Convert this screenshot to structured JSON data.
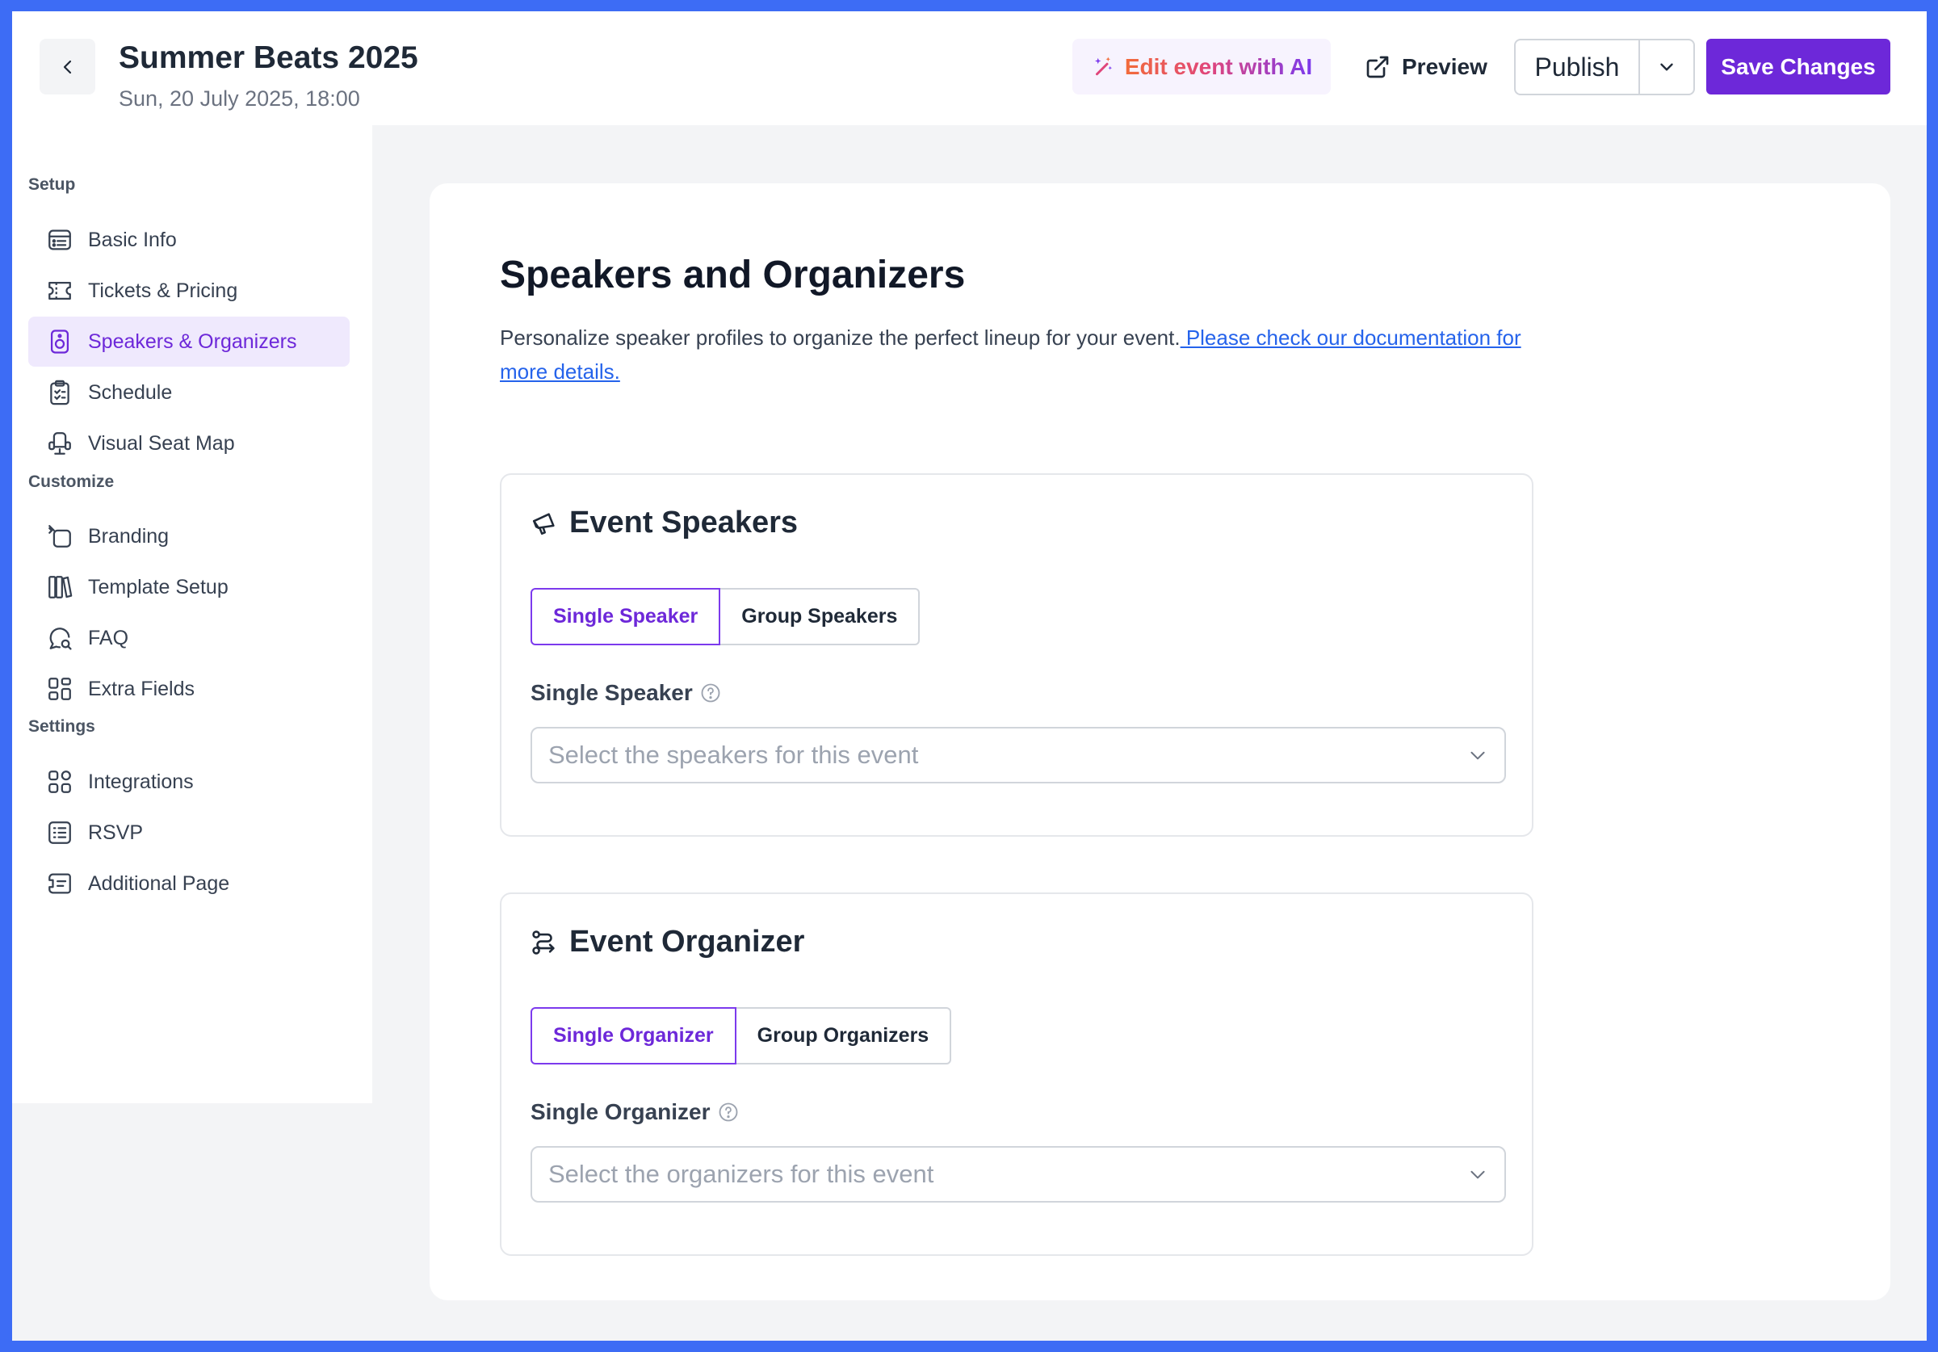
{
  "header": {
    "event_title": "Summer Beats 2025",
    "event_date": "Sun, 20 July 2025, 18:00",
    "ai_button": "Edit event with AI",
    "preview_button": "Preview",
    "publish_button": "Publish",
    "save_button": "Save Changes"
  },
  "sidebar": {
    "sections": [
      {
        "label": "Setup",
        "items": [
          {
            "label": "Basic Info",
            "icon": "basic-info-icon"
          },
          {
            "label": "Tickets & Pricing",
            "icon": "ticket-icon"
          },
          {
            "label": "Speakers & Organizers",
            "icon": "speaker-icon",
            "active": true
          },
          {
            "label": "Schedule",
            "icon": "clipboard-icon"
          },
          {
            "label": "Visual Seat Map",
            "icon": "seat-icon"
          }
        ]
      },
      {
        "label": "Customize",
        "items": [
          {
            "label": "Branding",
            "icon": "branding-icon"
          },
          {
            "label": "Template Setup",
            "icon": "template-icon"
          },
          {
            "label": "FAQ",
            "icon": "faq-icon"
          },
          {
            "label": "Extra Fields",
            "icon": "extra-fields-icon"
          }
        ]
      },
      {
        "label": "Settings",
        "items": [
          {
            "label": "Integrations",
            "icon": "integrations-icon"
          },
          {
            "label": "RSVP",
            "icon": "rsvp-icon"
          },
          {
            "label": "Additional Page",
            "icon": "additional-page-icon"
          }
        ]
      }
    ]
  },
  "main": {
    "title": "Speakers and Organizers",
    "description": "Personalize speaker profiles to organize the perfect lineup for your event.",
    "doc_link": " Please check our documentation for more details.",
    "speakers": {
      "heading": "Event Speakers",
      "tabs": [
        "Single Speaker",
        "Group Speakers"
      ],
      "field_label": "Single Speaker",
      "placeholder": "Select the speakers for this event"
    },
    "organizers": {
      "heading": "Event Organizer",
      "tabs": [
        "Single Organizer",
        "Group Organizers"
      ],
      "field_label": "Single Organizer",
      "placeholder": "Select the organizers for this event"
    }
  },
  "colors": {
    "accent": "#6d28d9",
    "active_bg": "#efe9fd",
    "frame": "#3d6cf5",
    "link": "#2563eb"
  }
}
